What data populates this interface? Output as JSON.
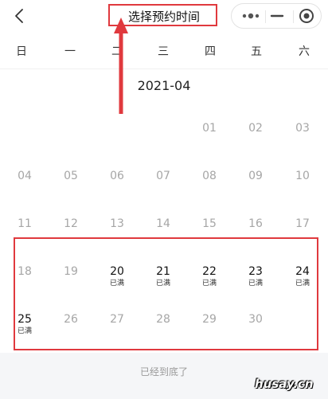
{
  "navbar": {
    "title": "选择预约时间"
  },
  "weekdays": [
    "日",
    "一",
    "二",
    "三",
    "四",
    "五",
    "六"
  ],
  "month": {
    "title": "2021-04",
    "rows": [
      [
        {
          "day": ""
        },
        {
          "day": ""
        },
        {
          "day": ""
        },
        {
          "day": ""
        },
        {
          "day": "01"
        },
        {
          "day": "02"
        },
        {
          "day": "03"
        }
      ],
      [
        {
          "day": "04"
        },
        {
          "day": "05"
        },
        {
          "day": "06"
        },
        {
          "day": "07"
        },
        {
          "day": "08"
        },
        {
          "day": "09"
        },
        {
          "day": "10"
        }
      ],
      [
        {
          "day": "11"
        },
        {
          "day": "12"
        },
        {
          "day": "13"
        },
        {
          "day": "14"
        },
        {
          "day": "15"
        },
        {
          "day": "16"
        },
        {
          "day": "17"
        }
      ],
      [
        {
          "day": "18"
        },
        {
          "day": "19"
        },
        {
          "day": "20",
          "status": "已满",
          "active": true
        },
        {
          "day": "21",
          "status": "已满",
          "active": true
        },
        {
          "day": "22",
          "status": "已满",
          "active": true
        },
        {
          "day": "23",
          "status": "已满",
          "active": true
        },
        {
          "day": "24",
          "status": "已满",
          "active": true
        }
      ],
      [
        {
          "day": "25",
          "status": "已满",
          "active": true
        },
        {
          "day": "26"
        },
        {
          "day": "27"
        },
        {
          "day": "28"
        },
        {
          "day": "29"
        },
        {
          "day": "30"
        },
        {
          "day": ""
        }
      ]
    ]
  },
  "footer": {
    "text": "已经到底了"
  },
  "watermark": "husay.cn",
  "colors": {
    "annotation": "#e0393e",
    "disabled_day": "#a6a6a6",
    "active_day": "#111111"
  }
}
